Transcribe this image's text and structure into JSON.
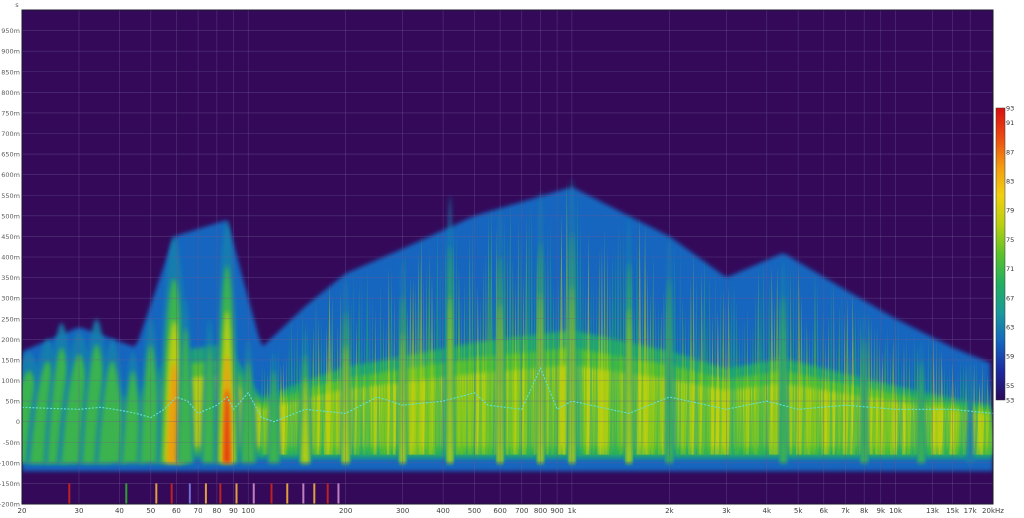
{
  "chart_data": {
    "type": "heatmap",
    "title": "",
    "xlabel": "",
    "ylabel": "",
    "y_unit": "s",
    "x_scale": "log",
    "xlim": [
      20,
      20000
    ],
    "ylim": [
      -0.2,
      1.0
    ],
    "x_major_ticks": [
      {
        "v": 20,
        "label": "20"
      },
      {
        "v": 30,
        "label": "30"
      },
      {
        "v": 40,
        "label": "40"
      },
      {
        "v": 50,
        "label": "50"
      },
      {
        "v": 60,
        "label": "60"
      },
      {
        "v": 70,
        "label": "70"
      },
      {
        "v": 80,
        "label": "80"
      },
      {
        "v": 90,
        "label": "90"
      },
      {
        "v": 100,
        "label": "100"
      },
      {
        "v": 200,
        "label": "200"
      },
      {
        "v": 300,
        "label": "300"
      },
      {
        "v": 400,
        "label": "400"
      },
      {
        "v": 500,
        "label": "500"
      },
      {
        "v": 600,
        "label": "600"
      },
      {
        "v": 700,
        "label": "700"
      },
      {
        "v": 800,
        "label": "800"
      },
      {
        "v": 900,
        "label": "900"
      },
      {
        "v": 1000,
        "label": "1k"
      },
      {
        "v": 2000,
        "label": "2k"
      },
      {
        "v": 3000,
        "label": "3k"
      },
      {
        "v": 4000,
        "label": "4k"
      },
      {
        "v": 5000,
        "label": "5k"
      },
      {
        "v": 6000,
        "label": "6k"
      },
      {
        "v": 7000,
        "label": "7k"
      },
      {
        "v": 8000,
        "label": "8k"
      },
      {
        "v": 9000,
        "label": "9k"
      },
      {
        "v": 10000,
        "label": "10k"
      },
      {
        "v": 13000,
        "label": "13k"
      },
      {
        "v": 15000,
        "label": "15k"
      },
      {
        "v": 17000,
        "label": "17k"
      },
      {
        "v": 20000,
        "label": "20kHz"
      }
    ],
    "y_ticks": [
      {
        "v": 0.95,
        "label": "950m"
      },
      {
        "v": 0.9,
        "label": "900m"
      },
      {
        "v": 0.85,
        "label": "850m"
      },
      {
        "v": 0.8,
        "label": "800m"
      },
      {
        "v": 0.75,
        "label": "750m"
      },
      {
        "v": 0.7,
        "label": "700m"
      },
      {
        "v": 0.65,
        "label": "650m"
      },
      {
        "v": 0.6,
        "label": "600m"
      },
      {
        "v": 0.55,
        "label": "550m"
      },
      {
        "v": 0.5,
        "label": "500m"
      },
      {
        "v": 0.45,
        "label": "450m"
      },
      {
        "v": 0.4,
        "label": "400m"
      },
      {
        "v": 0.35,
        "label": "350m"
      },
      {
        "v": 0.3,
        "label": "300m"
      },
      {
        "v": 0.25,
        "label": "250m"
      },
      {
        "v": 0.2,
        "label": "200m"
      },
      {
        "v": 0.15,
        "label": "150m"
      },
      {
        "v": 0.1,
        "label": "100m"
      },
      {
        "v": 0.05,
        "label": "50m"
      },
      {
        "v": 0.0,
        "label": "0"
      },
      {
        "v": -0.05,
        "label": "-50m"
      },
      {
        "v": -0.1,
        "label": "-100m"
      },
      {
        "v": -0.15,
        "label": "-150m"
      },
      {
        "v": -0.2,
        "label": "-200m"
      }
    ],
    "colorbar": {
      "min": 53,
      "max": 93,
      "tick_labels": [
        "93",
        "91",
        "87",
        "83",
        "79",
        "75",
        "71",
        "67",
        "63",
        "59",
        "55",
        "53"
      ],
      "colors": [
        "#2c0a5a",
        "#1c2aa0",
        "#1466c0",
        "#1a9a9a",
        "#22b060",
        "#5cc22a",
        "#b8d010",
        "#f0d010",
        "#f49a10",
        "#ec4a10",
        "#d81010"
      ]
    },
    "peak_ridges": [
      {
        "f": 21,
        "top": 0.17,
        "w": 0.06,
        "int": 0.25
      },
      {
        "f": 24,
        "top": 0.2,
        "w": 0.05,
        "int": 0.3
      },
      {
        "f": 26.5,
        "top": 0.24,
        "w": 0.04,
        "int": 0.3
      },
      {
        "f": 30,
        "top": 0.22,
        "w": 0.05,
        "int": 0.35
      },
      {
        "f": 34,
        "top": 0.25,
        "w": 0.04,
        "int": 0.35
      },
      {
        "f": 38,
        "top": 0.2,
        "w": 0.04,
        "int": 0.3
      },
      {
        "f": 44,
        "top": 0.17,
        "w": 0.03,
        "int": 0.25
      },
      {
        "f": 50,
        "top": 0.25,
        "w": 0.03,
        "int": 0.3
      },
      {
        "f": 59,
        "top": 0.45,
        "w": 0.04,
        "int": 0.85
      },
      {
        "f": 64,
        "top": 0.3,
        "w": 0.02,
        "int": 0.4
      },
      {
        "f": 76,
        "top": 0.25,
        "w": 0.02,
        "int": 0.35
      },
      {
        "f": 86,
        "top": 0.49,
        "w": 0.03,
        "int": 1.0
      },
      {
        "f": 100,
        "top": 0.2,
        "w": 0.02,
        "int": 0.35
      },
      {
        "f": 120,
        "top": 0.17,
        "w": 0.015,
        "int": 0.45
      },
      {
        "f": 150,
        "top": 0.22,
        "w": 0.015,
        "int": 0.5
      },
      {
        "f": 200,
        "top": 0.35,
        "w": 0.012,
        "int": 0.55
      },
      {
        "f": 300,
        "top": 0.4,
        "w": 0.01,
        "int": 0.65
      },
      {
        "f": 420,
        "top": 0.55,
        "w": 0.01,
        "int": 0.6
      },
      {
        "f": 600,
        "top": 0.52,
        "w": 0.01,
        "int": 0.55
      },
      {
        "f": 800,
        "top": 0.56,
        "w": 0.01,
        "int": 0.6
      },
      {
        "f": 1000,
        "top": 0.59,
        "w": 0.01,
        "int": 0.55
      },
      {
        "f": 1500,
        "top": 0.5,
        "w": 0.01,
        "int": 0.5
      },
      {
        "f": 2000,
        "top": 0.45,
        "w": 0.01,
        "int": 0.45
      },
      {
        "f": 4500,
        "top": 0.4,
        "w": 0.01,
        "int": 0.45
      },
      {
        "f": 8000,
        "top": 0.27,
        "w": 0.01,
        "int": 0.35
      },
      {
        "f": 12000,
        "top": 0.2,
        "w": 0.01,
        "int": 0.3
      },
      {
        "f": 17000,
        "top": 0.15,
        "w": 0.01,
        "int": 0.2
      }
    ],
    "envelope": [
      {
        "f": 20,
        "top": 0.17
      },
      {
        "f": 30,
        "top": 0.23
      },
      {
        "f": 45,
        "top": 0.18
      },
      {
        "f": 59,
        "top": 0.45
      },
      {
        "f": 86,
        "top": 0.49
      },
      {
        "f": 110,
        "top": 0.18
      },
      {
        "f": 150,
        "top": 0.28
      },
      {
        "f": 200,
        "top": 0.36
      },
      {
        "f": 300,
        "top": 0.42
      },
      {
        "f": 500,
        "top": 0.5
      },
      {
        "f": 1000,
        "top": 0.57
      },
      {
        "f": 2000,
        "top": 0.45
      },
      {
        "f": 3000,
        "top": 0.35
      },
      {
        "f": 4500,
        "top": 0.41
      },
      {
        "f": 7000,
        "top": 0.32
      },
      {
        "f": 10000,
        "top": 0.25
      },
      {
        "f": 15000,
        "top": 0.18
      },
      {
        "f": 20000,
        "top": 0.14
      }
    ],
    "tail_floor": -0.12,
    "group_delay_line": {
      "color": "#5fe3d8",
      "points": [
        [
          20,
          0.035
        ],
        [
          25,
          0.032
        ],
        [
          30,
          0.03
        ],
        [
          35,
          0.035
        ],
        [
          40,
          0.028
        ],
        [
          45,
          0.02
        ],
        [
          50,
          0.01
        ],
        [
          55,
          0.03
        ],
        [
          60,
          0.06
        ],
        [
          65,
          0.05
        ],
        [
          70,
          0.02
        ],
        [
          80,
          0.04
        ],
        [
          86,
          0.06
        ],
        [
          90,
          0.03
        ],
        [
          100,
          0.07
        ],
        [
          110,
          0.01
        ],
        [
          120,
          0.0
        ],
        [
          150,
          0.03
        ],
        [
          200,
          0.02
        ],
        [
          250,
          0.06
        ],
        [
          300,
          0.04
        ],
        [
          400,
          0.05
        ],
        [
          500,
          0.07
        ],
        [
          550,
          0.04
        ],
        [
          700,
          0.03
        ],
        [
          800,
          0.13
        ],
        [
          900,
          0.03
        ],
        [
          1000,
          0.05
        ],
        [
          1500,
          0.02
        ],
        [
          2000,
          0.06
        ],
        [
          3000,
          0.03
        ],
        [
          4000,
          0.05
        ],
        [
          5000,
          0.03
        ],
        [
          7000,
          0.04
        ],
        [
          10000,
          0.03
        ],
        [
          15000,
          0.03
        ],
        [
          20000,
          0.02
        ]
      ]
    },
    "floor_markers": [
      {
        "f": 28,
        "color": "#c02020"
      },
      {
        "f": 42,
        "color": "#30a030"
      },
      {
        "f": 52,
        "color": "#e0a040"
      },
      {
        "f": 58,
        "color": "#c02020"
      },
      {
        "f": 66,
        "color": "#7070d0"
      },
      {
        "f": 74,
        "color": "#e0a040"
      },
      {
        "f": 82,
        "color": "#c02020"
      },
      {
        "f": 92,
        "color": "#e0a040"
      },
      {
        "f": 104,
        "color": "#c080c0"
      },
      {
        "f": 118,
        "color": "#c02020"
      },
      {
        "f": 132,
        "color": "#e0a040"
      },
      {
        "f": 148,
        "color": "#c080c0"
      },
      {
        "f": 160,
        "color": "#e0a040"
      },
      {
        "f": 176,
        "color": "#c02020"
      },
      {
        "f": 190,
        "color": "#c080c0"
      }
    ]
  },
  "colors": {
    "plot_background": "#34095a",
    "grid": "#6e5a92",
    "frame": "#1a1a2a"
  }
}
